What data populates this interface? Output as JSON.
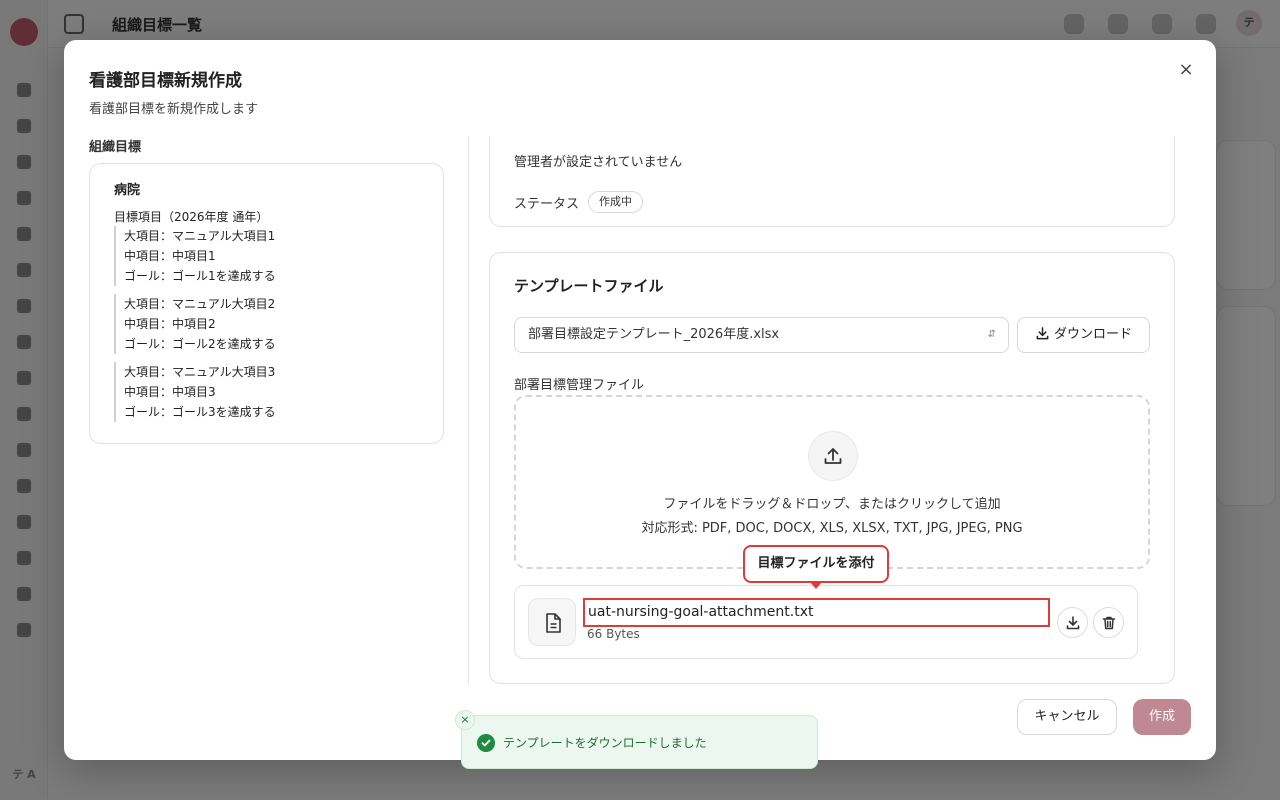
{
  "app": {
    "page_title": "組織目標一覧",
    "user_initials": "テ",
    "sidebar_user_initials": "テ A"
  },
  "modal": {
    "title": "看護部目標新規作成",
    "description": "看護部目標を新規作成します",
    "close_icon": "×"
  },
  "org_goals": {
    "label": "組織目標",
    "hospital": "病院",
    "period": "目標項目（2026年度 通年）",
    "groups": [
      {
        "major": "大項目：マニュアル大項目1",
        "middle": "中項目：中項目1",
        "goal": "ゴール：ゴール1を達成する"
      },
      {
        "major": "大項目：マニュアル大項目2",
        "middle": "中項目：中項目2",
        "goal": "ゴール：ゴール2を達成する"
      },
      {
        "major": "大項目：マニュアル大項目3",
        "middle": "中項目：中項目3",
        "goal": "ゴール：ゴール3を達成する"
      }
    ]
  },
  "info_card": {
    "manager_text": "管理者が設定されていません",
    "status_label": "ステータス",
    "status_value": "作成中"
  },
  "template": {
    "title": "テンプレートファイル",
    "selected_file": "部署目標設定テンプレート_2026年度.xlsx",
    "download_label": "ダウンロード",
    "file_section_label": "部署目標管理ファイル",
    "dropzone_main": "ファイルをドラッグ＆ドロップ、またはクリックして追加",
    "dropzone_formats": "対応形式: PDF, DOC, DOCX, XLS, XLSX, TXT, JPG, JPEG, PNG",
    "attached_file": {
      "name": "uat-nursing-goal-attachment.txt",
      "size": "66 Bytes"
    }
  },
  "tooltip": {
    "text": "目標ファイルを添付"
  },
  "footer": {
    "cancel_label": "キャンセル",
    "create_label": "作成"
  },
  "toast": {
    "message": "テンプレートをダウンロードしました",
    "close_icon": "×"
  },
  "colors": {
    "accent": "#c08893",
    "highlight_red": "#e03a3a",
    "success_green": "#1f8a43"
  }
}
